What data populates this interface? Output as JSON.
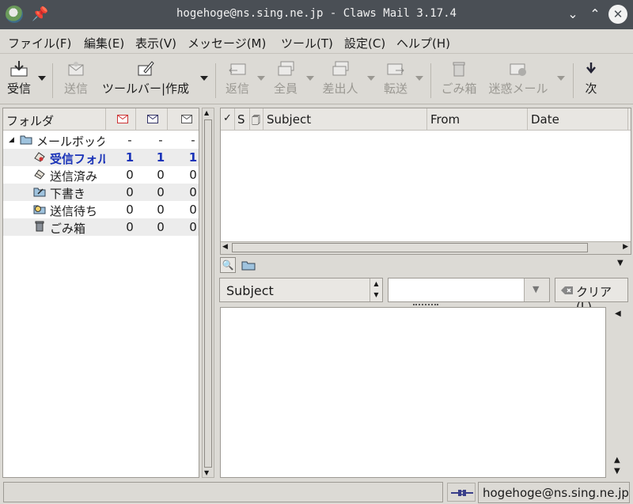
{
  "window": {
    "title": "hogehoge@ns.sing.ne.jp - Claws Mail 3.17.4"
  },
  "menu": [
    "ファイル(F)",
    "編集(E)",
    "表示(V)",
    "メッセージ(M)",
    "ツール(T)",
    "設定(C)",
    "ヘルプ(H)"
  ],
  "toolbar": {
    "receive": "受信",
    "send": "送信",
    "compose": "ツールバー|作成",
    "reply": "返信",
    "reply_all": "全員",
    "reply_sender": "差出人",
    "forward": "転送",
    "trash": "ごみ箱",
    "spam": "迷惑メール",
    "next": "次"
  },
  "folders": {
    "header": "フォルダ",
    "rows": [
      {
        "name": "メールボック",
        "new": "-",
        "unread": "-",
        "total": "-"
      },
      {
        "name": "受信フォル",
        "new": "1",
        "unread": "1",
        "total": "1"
      },
      {
        "name": "送信済み",
        "new": "0",
        "unread": "0",
        "total": "0"
      },
      {
        "name": "下書き",
        "new": "0",
        "unread": "0",
        "total": "0"
      },
      {
        "name": "送信待ち",
        "new": "0",
        "unread": "0",
        "total": "0"
      },
      {
        "name": "ごみ箱",
        "new": "0",
        "unread": "0",
        "total": "0"
      }
    ]
  },
  "messages": {
    "columns": {
      "mark": "✓",
      "status": "S",
      "attach": "🗍",
      "subject": "Subject",
      "from": "From",
      "date": "Date"
    }
  },
  "search": {
    "field": "Subject",
    "value": "",
    "clear": "クリア(L)"
  },
  "status": {
    "text": "",
    "account": "hogehoge@ns.sing.ne.jp"
  },
  "colors": {
    "titlebar": "#4a4f55",
    "unread_folder": "#1a33b8",
    "chrome": "#dcdad5"
  }
}
